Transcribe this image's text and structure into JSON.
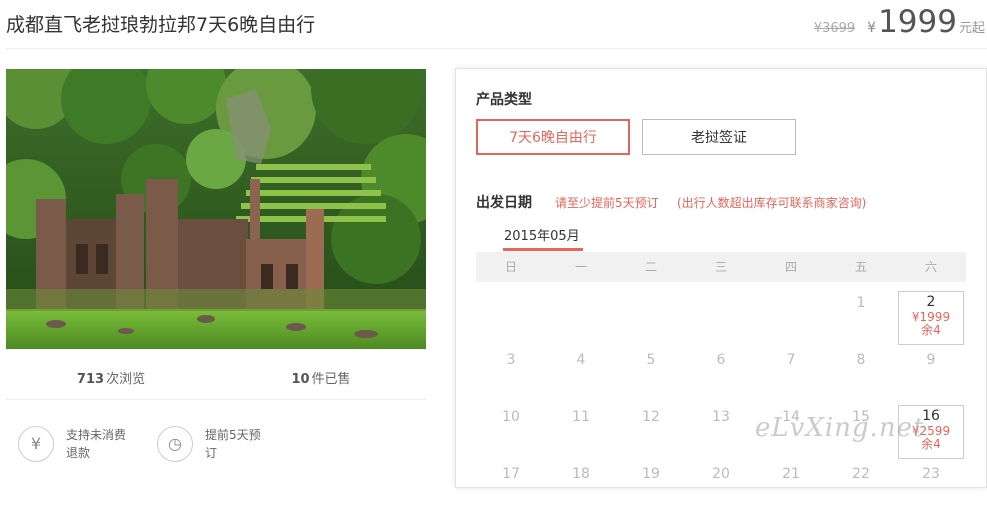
{
  "product": {
    "title": "成都直飞老挝琅勃拉邦7天6晚自由行",
    "original_price": "¥3699",
    "currency": "¥",
    "price": "1999",
    "price_suffix": "元起"
  },
  "stats": {
    "views": "713",
    "views_label": "次浏览",
    "sold": "10",
    "sold_label": "件已售"
  },
  "features": [
    {
      "icon": "yuan-icon",
      "glyph": "¥",
      "text": "支持未消费\n退款"
    },
    {
      "icon": "clock-icon",
      "glyph": "◷",
      "text": "提前5天预\n订"
    }
  ],
  "panel": {
    "type_label": "产品类型",
    "options": [
      "7天6晚自由行",
      "老挝签证"
    ],
    "selected_option": 0,
    "date_label": "出发日期",
    "hint1": "请至少提前5天预订",
    "hint2": "(出行人数超出库存可联系商家咨询)",
    "month": "2015年05月",
    "weekdays": [
      "日",
      "一",
      "二",
      "三",
      "四",
      "五",
      "六"
    ],
    "weeks": [
      [
        {
          "d": ""
        },
        {
          "d": ""
        },
        {
          "d": ""
        },
        {
          "d": ""
        },
        {
          "d": ""
        },
        {
          "d": "1"
        },
        {
          "d": "2",
          "price": "¥1999",
          "stock": "余4"
        }
      ],
      [
        {
          "d": "3"
        },
        {
          "d": "4"
        },
        {
          "d": "5"
        },
        {
          "d": "6"
        },
        {
          "d": "7"
        },
        {
          "d": "8"
        },
        {
          "d": "9"
        }
      ],
      [
        {
          "d": "10"
        },
        {
          "d": "11"
        },
        {
          "d": "12"
        },
        {
          "d": "13"
        },
        {
          "d": "14"
        },
        {
          "d": "15"
        },
        {
          "d": "16",
          "price": "¥2599",
          "stock": "余4"
        }
      ],
      [
        {
          "d": "17"
        },
        {
          "d": "18"
        },
        {
          "d": "19"
        },
        {
          "d": "20"
        },
        {
          "d": "21"
        },
        {
          "d": "22"
        },
        {
          "d": "23"
        }
      ]
    ]
  },
  "watermark": "eLvXing.net",
  "colors": {
    "accent": "#e5655a",
    "muted": "#bbbbbb"
  }
}
